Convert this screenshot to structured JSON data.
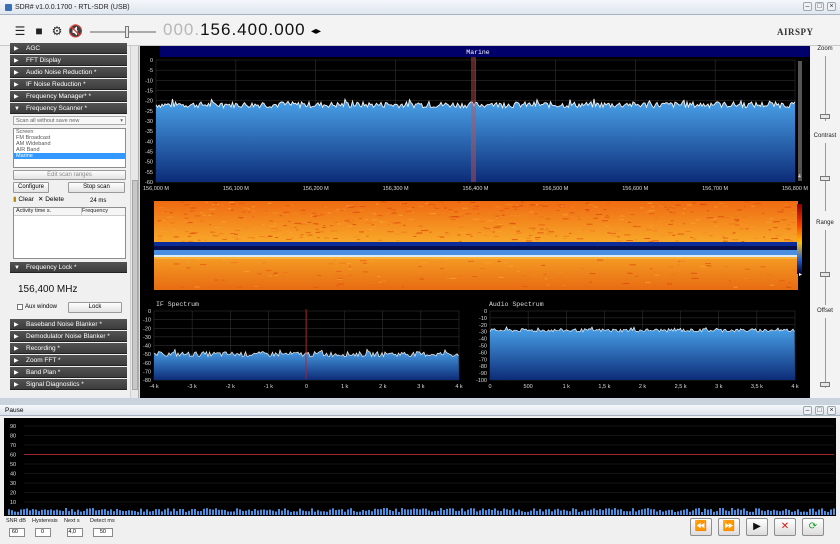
{
  "window": {
    "title": "SDR# v1.0.0.1700 - RTL-SDR (USB)"
  },
  "toolbar": {
    "frequency_prefix": "000.",
    "frequency_main": "156.400.000",
    "brand": "AIRSPY"
  },
  "sidebar": {
    "panels_top": [
      {
        "label": "AGC",
        "state": "collapsed"
      },
      {
        "label": "FFT Display",
        "state": "collapsed"
      },
      {
        "label": "Audio Noise Reduction *",
        "state": "collapsed"
      },
      {
        "label": "IF Noise Reduction *",
        "state": "collapsed"
      },
      {
        "label": "Frequency Manager* *",
        "state": "collapsed"
      },
      {
        "label": "Frequency Scanner *",
        "state": "expanded"
      }
    ],
    "scanner": {
      "mode_select": "Scan all without save new",
      "ranges": [
        "Screen",
        "FM Broadcast",
        "AM Wideband",
        "AIR Band",
        "Marine"
      ],
      "selected_range_index": 4,
      "edit_ranges_label": "Edit scan ranges",
      "configure_label": "Configure",
      "stop_scan_label": "Stop scan",
      "clear_label": "Clear",
      "delete_label": "Delete",
      "timing": "24 ms",
      "col_activity": "Activity time s.",
      "col_frequency": "Frequency"
    },
    "frequency_lock": {
      "header": "Frequency Lock *",
      "value": "156,400 MHz",
      "aux_window_label": "Aux window",
      "lock_label": "Lock"
    },
    "panels_bottom": [
      {
        "label": "Baseband Noise Blanker *"
      },
      {
        "label": "Demodulator Noise Blanker *"
      },
      {
        "label": "Recording *"
      },
      {
        "label": "Zoom FFT *"
      },
      {
        "label": "Band Plan *"
      },
      {
        "label": "Signal Diagnostics *"
      }
    ]
  },
  "right_panel": {
    "zoom": "Zoom",
    "contrast": "Contrast",
    "range": "Range",
    "offset": "Offset"
  },
  "main_spectrum": {
    "band_label": "Marine",
    "y_ticks": [
      "0",
      "-5",
      "-10",
      "-15",
      "-20",
      "-25",
      "-30",
      "-35",
      "-40",
      "-45",
      "-50",
      "-55",
      "-60"
    ],
    "x_ticks": [
      "156,000 M",
      "156,100 M",
      "156,200 M",
      "156,300 M",
      "156,400 M",
      "156,500 M",
      "156,600 M",
      "156,700 M",
      "156,800 M"
    ],
    "noise_floor_db": -22,
    "scroll_marker": "4"
  },
  "if_spectrum": {
    "title": "IF Spectrum",
    "y_ticks": [
      "0",
      "-10",
      "-20",
      "-30",
      "-40",
      "-50",
      "-60",
      "-70",
      "-80"
    ],
    "x_ticks": [
      "-4 k",
      "-3 k",
      "-2 k",
      "-1 k",
      "0",
      "1 k",
      "2 k",
      "3 k",
      "4 k"
    ],
    "noise_floor_db": -50
  },
  "audio_spectrum": {
    "title": "Audio Spectrum",
    "y_ticks": [
      "0",
      "-10",
      "-20",
      "-30",
      "-40",
      "-50",
      "-60",
      "-70",
      "-80",
      "-90",
      "-100"
    ],
    "x_ticks": [
      "0",
      "500",
      "1 k",
      "1,5 k",
      "2 k",
      "2,5 k",
      "3 k",
      "3,5 k",
      "4 k"
    ],
    "noise_floor_db": -28
  },
  "lower_panel": {
    "title": "Pause",
    "y_ticks": [
      "90",
      "80",
      "70",
      "60",
      "50",
      "40",
      "30",
      "20",
      "10"
    ],
    "threshold_db": 60,
    "threshold_color": "#c83232",
    "controls": [
      {
        "label": "SNR dB",
        "value": "60"
      },
      {
        "label": "Hysteresis",
        "value": "0"
      },
      {
        "label": "Next s",
        "value": "4,0"
      },
      {
        "label": "Detect ms",
        "value": "50"
      }
    ],
    "nav": {
      "rewind": "⏪",
      "forward": "⏩",
      "play": "▶",
      "stop": "✕",
      "refresh": "⟳"
    }
  }
}
